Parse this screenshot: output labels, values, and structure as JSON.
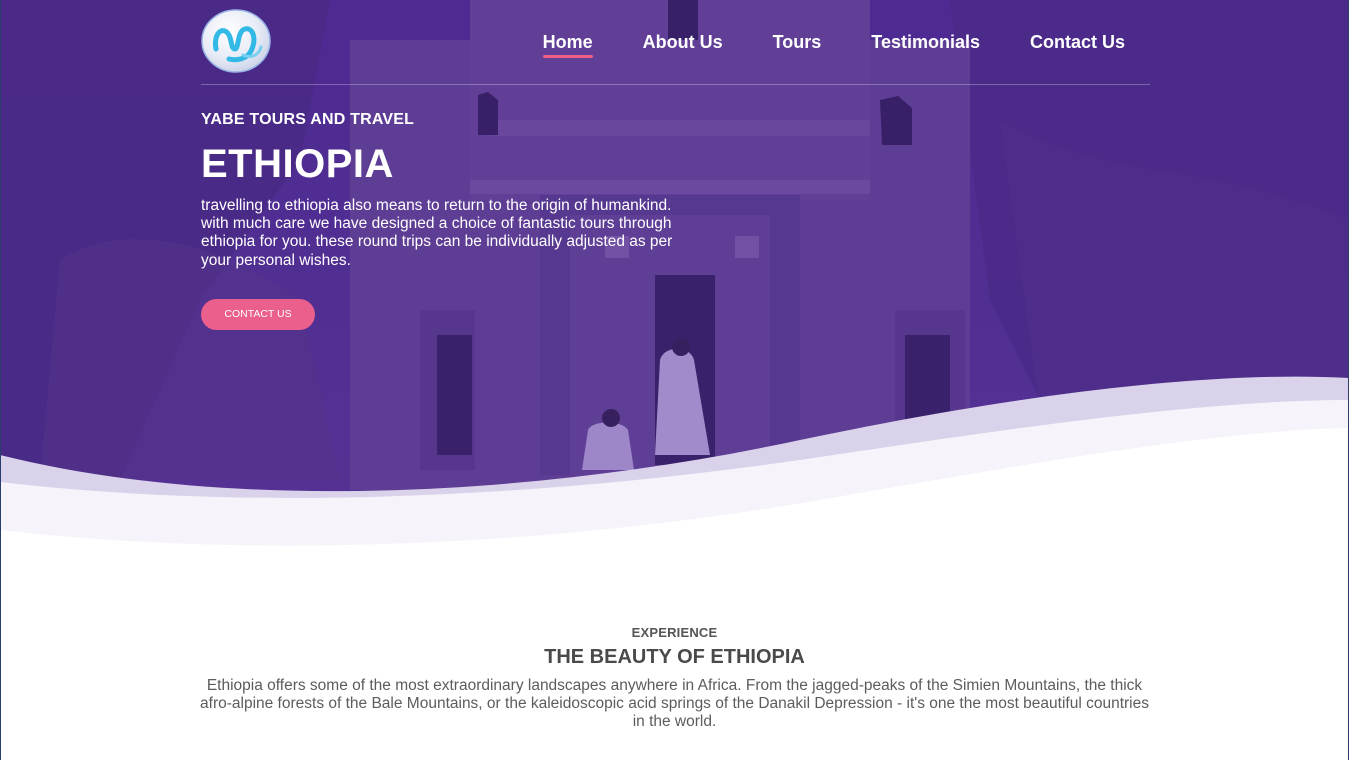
{
  "nav": {
    "items": [
      {
        "label": "Home",
        "active": true
      },
      {
        "label": "About Us"
      },
      {
        "label": "Tours"
      },
      {
        "label": "Testimonials"
      },
      {
        "label": "Contact Us"
      }
    ]
  },
  "hero": {
    "eyebrow": "YABE TOURS AND TRAVEL",
    "title": "ETHIOPIA",
    "description": "travelling to ethiopia also means to return to the origin of humankind. with much care we have designed a choice of fantastic tours through ethiopia for you. these round trips can be individually adjusted as per your personal wishes.",
    "cta_label": "CONTACT US"
  },
  "experience": {
    "eyebrow": "EXPERIENCE",
    "title": "THE BEAUTY OF ETHIOPIA",
    "description": "Ethiopia offers some of the most extraordinary landscapes anywhere in Africa. From the jagged-peaks of the Simien Mountains, the thick afro-alpine forests of the Bale Mountains, or the kaleidoscopic acid springs of the Danakil Depression - it's one the most beautiful countries in the world."
  },
  "colors": {
    "overlay": "#4b2a91",
    "accent": "#ea5f8b",
    "text_light": "#ffffff",
    "text_dark": "#5a5a5a"
  },
  "icons": {
    "logo": "yabe-logo-icon"
  }
}
